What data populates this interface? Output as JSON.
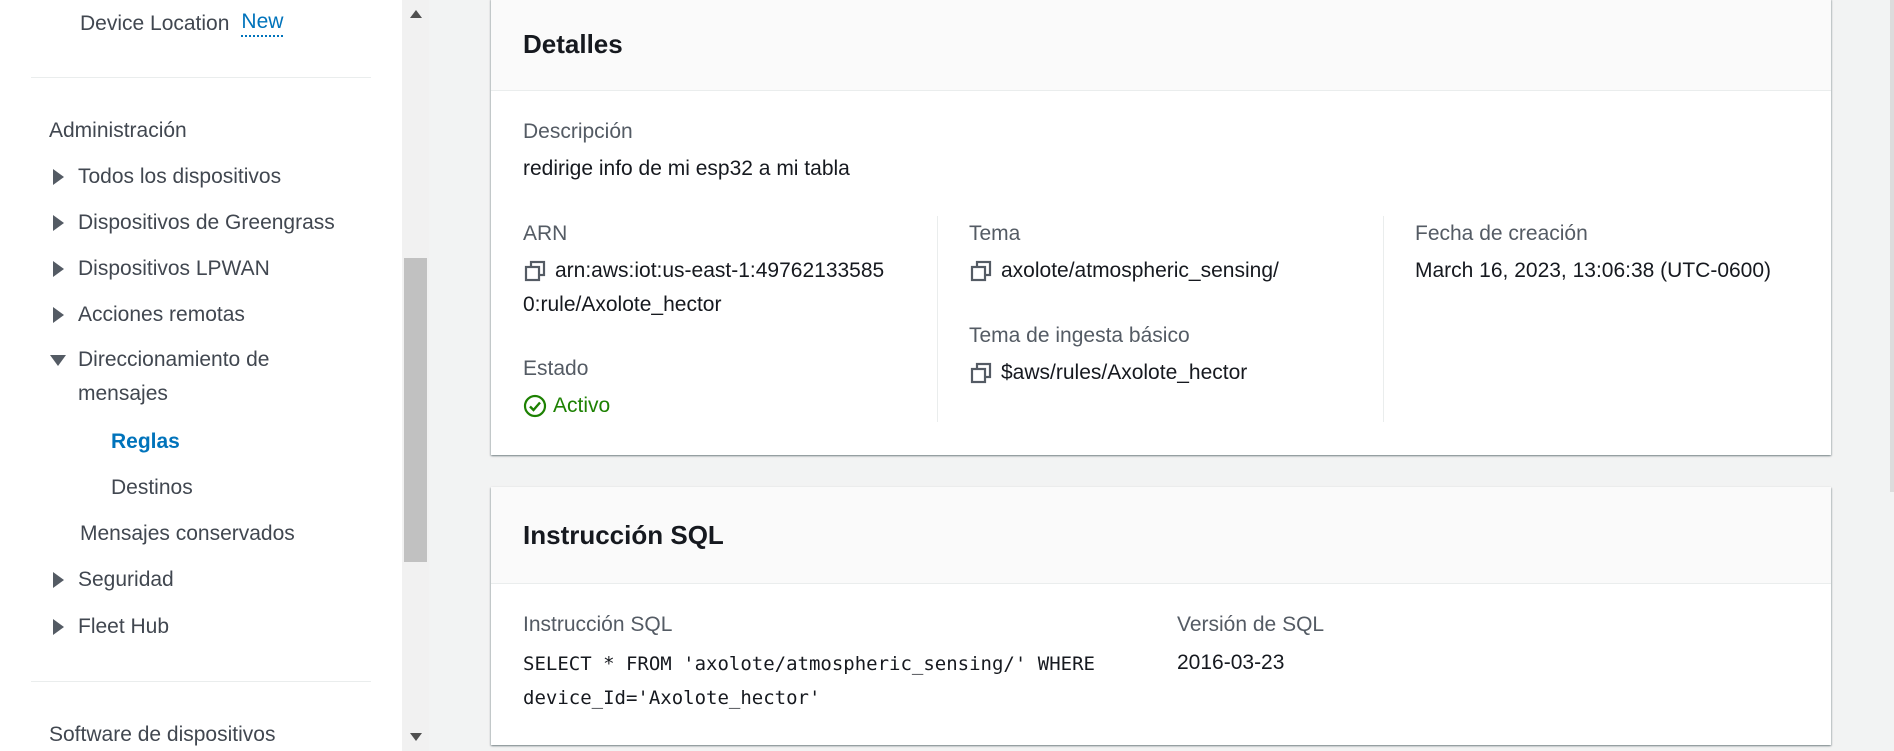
{
  "sidebar": {
    "device_location": {
      "label": "Device Location",
      "badge": "New"
    },
    "section_admin": "Administración",
    "items": [
      {
        "label": "Todos los dispositivos"
      },
      {
        "label": "Dispositivos de Greengrass"
      },
      {
        "label": "Dispositivos LPWAN"
      },
      {
        "label": "Acciones remotas"
      },
      {
        "label": "Direccionamiento de mensajes"
      }
    ],
    "sub_items": [
      {
        "label": "Reglas"
      },
      {
        "label": "Destinos"
      }
    ],
    "retained": "Mensajes conservados",
    "more_items": [
      {
        "label": "Seguridad"
      },
      {
        "label": "Fleet Hub"
      }
    ],
    "section_software": "Software de dispositivos"
  },
  "details": {
    "title": "Detalles",
    "description_label": "Descripción",
    "description_value": "redirige info de mi esp32 a mi tabla",
    "arn_label": "ARN",
    "arn_value_line1": "arn:aws:iot:us-east-1:49762133585",
    "arn_value_line2": "0:rule/Axolote_hector",
    "status_label": "Estado",
    "status_value": "Activo",
    "topic_label": "Tema",
    "topic_value": "axolote/atmospheric_sensing/",
    "basic_ingest_label": "Tema de ingesta básico",
    "basic_ingest_value": "$aws/rules/Axolote_hector",
    "created_label": "Fecha de creación",
    "created_value": "March 16, 2023, 13:06:38 (UTC-0600)"
  },
  "sql": {
    "title": "Instrucción SQL",
    "statement_label": "Instrucción SQL",
    "statement_line1": "SELECT * FROM 'axolote/atmospheric_sensing/' WHERE",
    "statement_line2": "device_Id='Axolote_hector'",
    "version_label": "Versión de SQL",
    "version_value": "2016-03-23"
  },
  "colors": {
    "accent": "#0073bb",
    "success": "#1d8102",
    "text": "#16191f",
    "muted": "#545b64"
  }
}
